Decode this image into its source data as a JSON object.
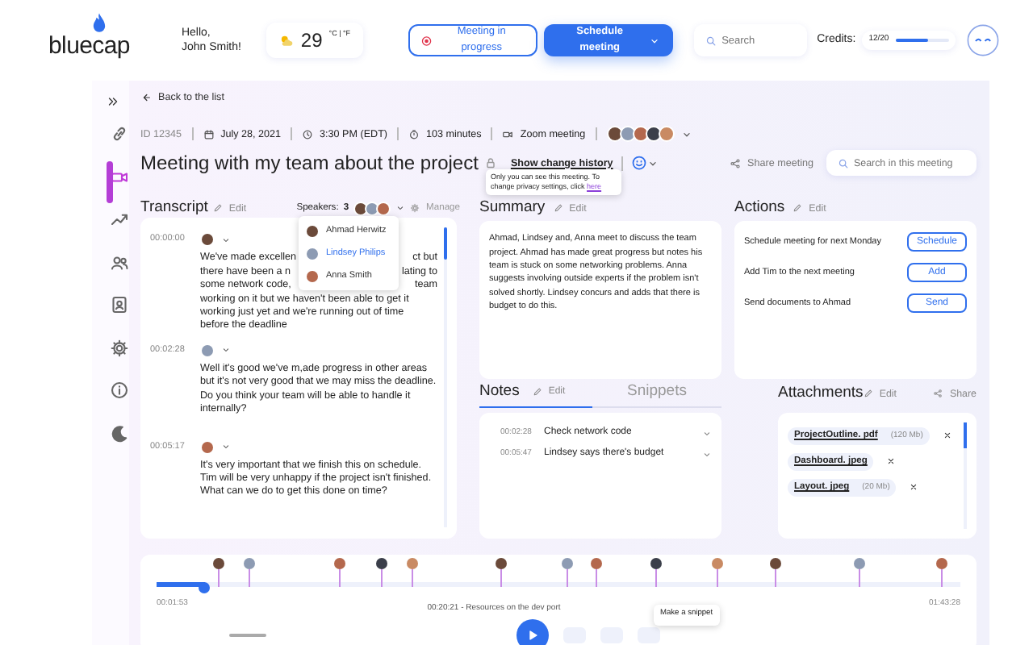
{
  "header": {
    "logo": "bluecap",
    "greeting_lines": [
      "Hello,",
      "John Smith!"
    ],
    "weather": {
      "temperature": "29",
      "units": "°C | °F"
    },
    "status_button": "Meeting in progress",
    "schedule_button": "Schedule meeting",
    "search": {
      "placeholder": "Search"
    },
    "credits": {
      "label": "Credits:",
      "value": "12/20",
      "level": 0.6
    }
  },
  "sidebar": {
    "items": [
      {
        "kind": "link",
        "selected": false
      },
      {
        "kind": "video",
        "selected": true
      },
      {
        "kind": "trend",
        "selected": false
      },
      {
        "kind": "users",
        "selected": false
      },
      {
        "kind": "contact",
        "selected": false
      },
      {
        "kind": "gear",
        "selected": false
      },
      {
        "kind": "info",
        "selected": false
      },
      {
        "kind": "moon",
        "selected": false
      }
    ]
  },
  "back_link": "Back to the list",
  "meta": {
    "id": "ID 12345",
    "date": "July 28, 2021",
    "time": "3:30 PM (EDT)",
    "duration": "103 minutes",
    "platform": "Zoom meeting"
  },
  "title": "Meeting with my team about the project",
  "private": true,
  "history_link": "Show change history",
  "share": "Share meeting",
  "meeting_search": {
    "placeholder": "Search in this meeting"
  },
  "privacy_tooltip": {
    "text": "Only you can see this meeting. To change privacy settings, click ",
    "link": "here"
  },
  "transcript": {
    "title": "Transcript",
    "edit": "Edit",
    "speakers_label": "Speakers:",
    "speakers_count": "3",
    "manage": "Manage",
    "entries": [
      {
        "time": "00:00:00",
        "lines": [
          [
            "We've made excellen",
            "ct but"
          ],
          [
            "there have been a n",
            "lating to"
          ],
          [
            "some network code,",
            "team"
          ],
          [
            "working on it but we haven't been able to get it"
          ],
          [
            "working just yet and we're running out of time"
          ],
          [
            "before the deadline"
          ]
        ]
      },
      {
        "time": "00:02:28",
        "text": "Well it's good we've m,ade progress in other areas but it's not very good that we may miss the deadline. Do you think your team will be able to handle it internally?"
      },
      {
        "time": "00:05:17",
        "text": "It's very important that we finish this on schedule. Tim will be very unhappy if the project isn't finished. What can we do to get this done on time?"
      }
    ]
  },
  "speaker_menu": [
    {
      "name": "Ahmad Herwitz",
      "selected": false
    },
    {
      "name": "Lindsey Philips",
      "selected": true
    },
    {
      "name": "Anna Smith",
      "selected": false
    }
  ],
  "summary": {
    "title": "Summary",
    "edit": "Edit",
    "text": "Ahmad, Lindsey and, Anna meet to discuss the team project. Ahmad has made great progress but notes his team is stuck on some networking problems. Anna suggests involving outside experts if the problem isn't solved shortly. Lindsey concurs and adds that there is budget to do this."
  },
  "actions": {
    "title": "Actions",
    "edit": "Edit",
    "items": [
      {
        "text": "Schedule meeting for next Monday",
        "button": "Schedule"
      },
      {
        "text": "Add Tim to the next meeting",
        "button": "Add"
      },
      {
        "text": "Send documents to Ahmad",
        "button": "Send"
      }
    ]
  },
  "notes": {
    "tabs": [
      {
        "label": "Notes",
        "selected": true
      },
      {
        "label": "Snippets",
        "selected": false
      }
    ],
    "edit": "Edit",
    "items": [
      {
        "time": "00:02:28",
        "text": "Check network code"
      },
      {
        "time": "00:05:47",
        "text": "Lindsey says there's budget"
      }
    ]
  },
  "attachments": {
    "title": "Attachments",
    "edit": "Edit",
    "share": "Share",
    "items": [
      {
        "name": "ProjectOutline. pdf",
        "size": "(120 Mb)"
      },
      {
        "name": "Dashboard. jpeg"
      },
      {
        "name": "Layout. jpeg",
        "size": "(20 Mb)"
      }
    ]
  },
  "timeline": {
    "level": 0.06,
    "start": "00:01:53",
    "end": "01:43:28",
    "marker_label": "00:20:21 - Resources on the dev port",
    "snippet_tooltip": "Make a snippet"
  }
}
